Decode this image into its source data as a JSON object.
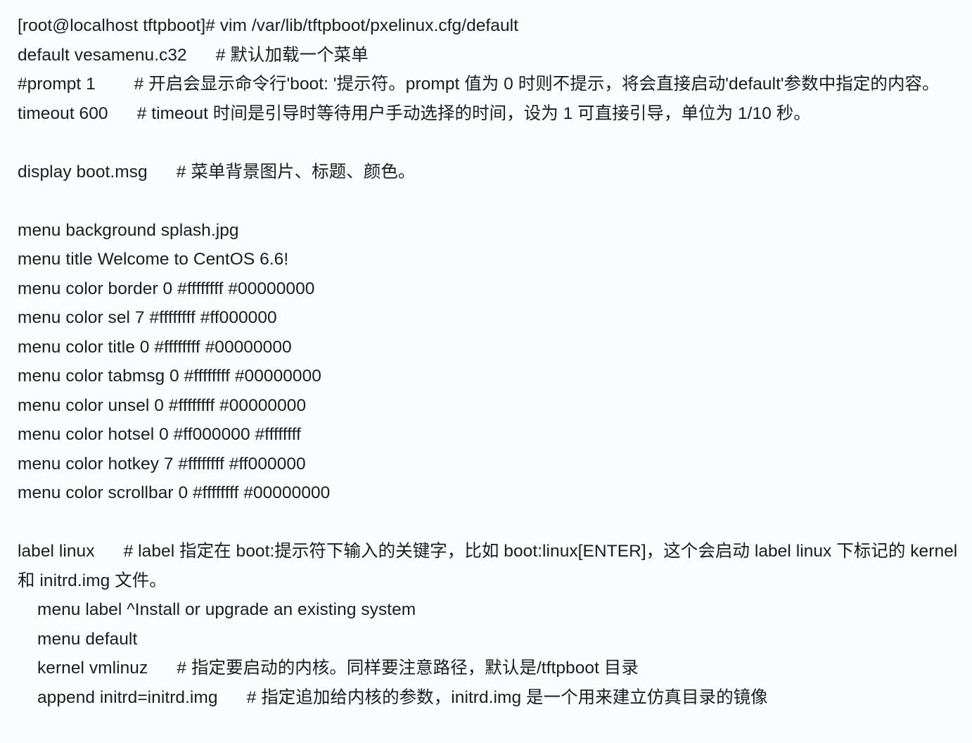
{
  "document": {
    "kind": "terminal-text-listing",
    "background_color": "#fbfcff",
    "text_color": "#1b1b24",
    "lines": [
      {
        "id": "prompt-command",
        "indent": 0,
        "text": "[root@localhost tftpboot]# vim /var/lib/tftpboot/pxelinux.cfg/default"
      },
      {
        "id": "default-vesamenu",
        "indent": 0,
        "text": "default vesamenu.c32      # 默认加载一个菜单"
      },
      {
        "id": "prompt-setting",
        "indent": 0,
        "text": "#prompt 1        # 开启会显示命令行'boot: '提示符。prompt 值为 0 时则不提示，将会直接启动'default'参数中指定的内容。"
      },
      {
        "id": "timeout-setting",
        "indent": 0,
        "text": "timeout 600      # timeout 时间是引导时等待用户手动选择的时间，设为 1 可直接引导，单位为 1/10 秒。"
      },
      {
        "id": "blank-1",
        "indent": 0,
        "text": ""
      },
      {
        "id": "display-bootmsg",
        "indent": 0,
        "text": "display boot.msg      # 菜单背景图片、标题、颜色。"
      },
      {
        "id": "blank-2",
        "indent": 0,
        "text": ""
      },
      {
        "id": "menu-background",
        "indent": 0,
        "text": "menu background splash.jpg"
      },
      {
        "id": "menu-title",
        "indent": 0,
        "text": "menu title Welcome to CentOS 6.6!"
      },
      {
        "id": "menu-color-border",
        "indent": 0,
        "text": "menu color border 0 #ffffffff #00000000"
      },
      {
        "id": "menu-color-sel",
        "indent": 0,
        "text": "menu color sel 7 #ffffffff #ff000000"
      },
      {
        "id": "menu-color-title",
        "indent": 0,
        "text": "menu color title 0 #ffffffff #00000000"
      },
      {
        "id": "menu-color-tabmsg",
        "indent": 0,
        "text": "menu color tabmsg 0 #ffffffff #00000000"
      },
      {
        "id": "menu-color-unsel",
        "indent": 0,
        "text": "menu color unsel 0 #ffffffff #00000000"
      },
      {
        "id": "menu-color-hotsel",
        "indent": 0,
        "text": "menu color hotsel 0 #ff000000 #ffffffff"
      },
      {
        "id": "menu-color-hotkey",
        "indent": 0,
        "text": "menu color hotkey 7 #ffffffff #ff000000"
      },
      {
        "id": "menu-color-scrollbar",
        "indent": 0,
        "text": "menu color scrollbar 0 #ffffffff #00000000"
      },
      {
        "id": "blank-3",
        "indent": 0,
        "text": ""
      },
      {
        "id": "label-linux",
        "indent": 0,
        "text": "label linux      # label 指定在 boot:提示符下输入的关键字，比如 boot:linux[ENTER]，这个会启动 label linux 下标记的 kernel 和 initrd.img 文件。"
      },
      {
        "id": "menu-label-install",
        "indent": 1,
        "text": "menu label ^Install or upgrade an existing system"
      },
      {
        "id": "menu-default",
        "indent": 1,
        "text": "menu default"
      },
      {
        "id": "kernel-vmlinuz",
        "indent": 1,
        "text": "kernel vmlinuz      # 指定要启动的内核。同样要注意路径，默认是/tftpboot 目录"
      },
      {
        "id": "append-initrd",
        "indent": 1,
        "text": "append initrd=initrd.img      # 指定追加给内核的参数，initrd.img 是一个用来建立仿真目录的镜像"
      }
    ]
  }
}
